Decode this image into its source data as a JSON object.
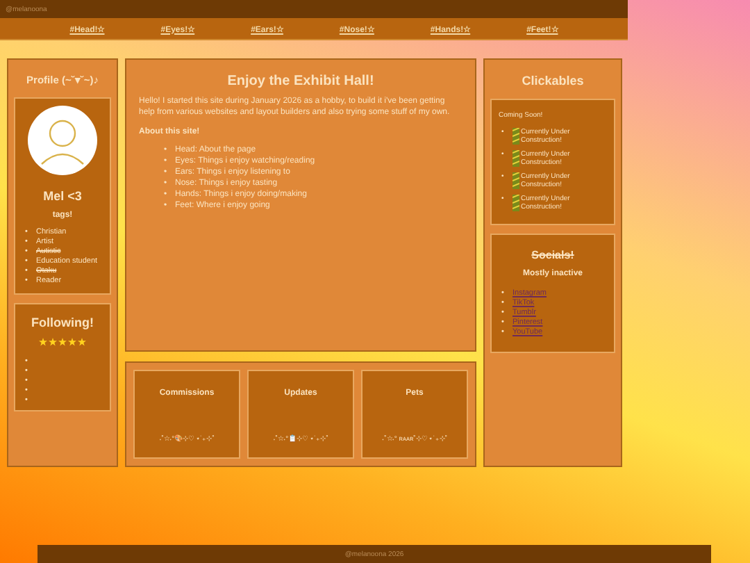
{
  "top_bar": {
    "handle": "@melanoona"
  },
  "nav": [
    {
      "label": "#Head!☆"
    },
    {
      "label": "#Eyes!☆"
    },
    {
      "label": "#Ears!☆"
    },
    {
      "label": "#Nose!☆"
    },
    {
      "label": "#Hands!☆"
    },
    {
      "label": "#Feet!☆"
    }
  ],
  "bullet": "•",
  "profile": {
    "title": "Profile (~˘▾˘~)♪",
    "name": "Mel <3",
    "tags_heading": "tags!",
    "tags": [
      {
        "label": "Christian",
        "struck": false
      },
      {
        "label": "Artist",
        "struck": false
      },
      {
        "label": "Autistic",
        "struck": true
      },
      {
        "label": "Education student",
        "struck": false
      },
      {
        "label": "Otaku",
        "struck": true
      },
      {
        "label": "Reader",
        "struck": false
      }
    ]
  },
  "following": {
    "title": "Following!",
    "stars": 5,
    "items": [
      {
        "bullet": "•"
      },
      {
        "bullet": "•"
      },
      {
        "bullet": "•"
      },
      {
        "bullet": "•"
      },
      {
        "bullet": "•"
      }
    ]
  },
  "main": {
    "title": "Enjoy the Exhibit Hall!",
    "intro": "Hello! I started this site during January 2026 as a hobby, to build it i've been getting help from various websites and layout builders and also trying some stuff of my own.",
    "about_heading": "About this site!",
    "about_items": [
      "Head: About the page",
      "Eyes: Things i enjoy watching/reading",
      "Ears: Things i enjoy listening to",
      "Nose: Things i enjoy tasting",
      "Hands: Things i enjoy doing/making",
      "Feet: Where i enjoy going"
    ]
  },
  "cards": [
    {
      "title": "Commissions",
      "decoration": "˖˚☆˖°🎨⊹♡ ⋆˙₊⊹˚"
    },
    {
      "title": "Updates",
      "decoration": "˖˚☆˖°📋⊹♡ ⋆˙₊⊹˚"
    },
    {
      "title": "Pets",
      "decoration": "˖˚☆˖° ʀᴀᴀʀ˚⊹♡ ⋆˙₊⊹˚"
    }
  ],
  "clickables": {
    "title": "Clickables",
    "note": "Coming Soon!",
    "items": [
      "Currently Under Construction!",
      "Currently Under Construction!",
      "Currently Under Construction!",
      "Currently Under Construction!"
    ]
  },
  "socials": {
    "title": "Socials!",
    "title_struck": true,
    "subtitle": "Mostly inactive",
    "links": [
      "Instagram",
      "TikTok",
      "Tumblr",
      "Pinterest",
      "YouTube"
    ]
  },
  "footer": {
    "text": "@melanoona 2026"
  }
}
